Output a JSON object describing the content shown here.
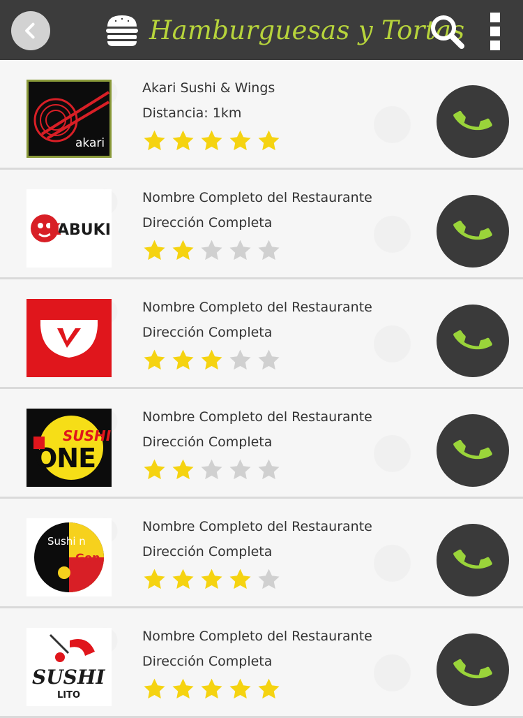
{
  "header": {
    "title": "Hamburguesas y Tortas",
    "accent_color": "#b7d43b",
    "background_color": "#3c3c3c",
    "icons": [
      "back-arrow-icon",
      "burger-icon",
      "search-icon",
      "more-vert-icon"
    ]
  },
  "restaurants": [
    {
      "name": "Akari Sushi & Wings",
      "detail": "Distancia: 1km",
      "rating": 5,
      "logo": "akari"
    },
    {
      "name": "Nombre  Completo del Restaurante",
      "detail": "Dirección Completa",
      "rating": 2,
      "logo": "kabuki"
    },
    {
      "name": "Nombre  Completo del Restaurante",
      "detail": "Dirección Completa",
      "rating": 3,
      "logo": "red-bowl"
    },
    {
      "name": "Nombre  Completo del Restaurante",
      "detail": "Dirección Completa",
      "rating": 2,
      "logo": "sushi-one"
    },
    {
      "name": "Nombre  Completo del Restaurante",
      "detail": "Dirección Completa",
      "rating": 4,
      "logo": "sushi-n-gon"
    },
    {
      "name": "Nombre  Completo del Restaurante",
      "detail": "Dirección Completa",
      "rating": 5,
      "logo": "sushito"
    }
  ],
  "logos": {
    "akari_text": "akari",
    "kabuki_text": "KABUKI",
    "sushi_one_top": "SUSHI",
    "sushi_one_bottom": "ONE",
    "sushi_n_gon_top": "Sushi n",
    "sushi_n_gon_bottom": "Gon",
    "sushito_text": "SUSHI",
    "sushito_sub": "LITO"
  },
  "colors": {
    "star_on": "#f5d311",
    "star_off": "#d0d0d0",
    "call_icon": "#9ad43a",
    "call_button": "#3a3a3a"
  }
}
